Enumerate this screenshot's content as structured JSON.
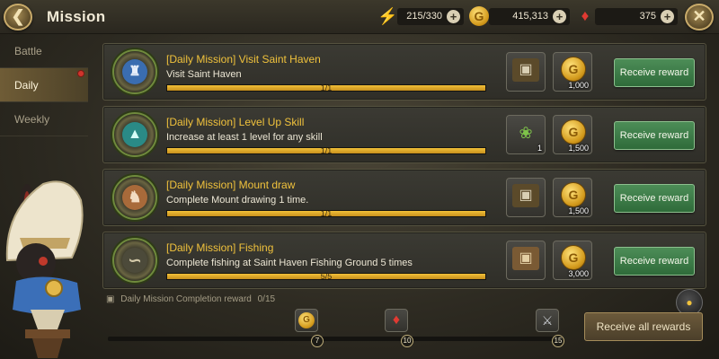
{
  "header": {
    "title": "Mission",
    "back_icon": "back-arrow-icon",
    "close_icon": "close-x-icon",
    "resources": [
      {
        "name": "energy",
        "icon": "lightning-icon",
        "value": "215/330",
        "color": "#6cc24a"
      },
      {
        "name": "gold",
        "icon": "coin-icon",
        "value": "415,313",
        "color": "#e0a624"
      },
      {
        "name": "gem",
        "icon": "ruby-icon",
        "value": "375",
        "color": "#d3322e"
      }
    ]
  },
  "nav": {
    "items": [
      {
        "label": "Battle",
        "active": false
      },
      {
        "label": "Daily",
        "active": true,
        "notification": true
      },
      {
        "label": "Weekly",
        "active": false
      }
    ]
  },
  "missions": [
    {
      "title": "[Daily Mission] Visit Saint Haven",
      "description": "Visit Saint Haven",
      "progress_text": "1/1",
      "progress": 1.0,
      "emblem_icon": "castle-icon",
      "rewards": [
        {
          "icon": "treasure-chest-icon",
          "count": ""
        },
        {
          "icon": "gold-coin-icon",
          "count": "1,000"
        }
      ],
      "button_label": "Receive reward"
    },
    {
      "title": "[Daily Mission] Level Up Skill",
      "description": "Increase at least 1 level for any skill",
      "progress_text": "1/1",
      "progress": 1.0,
      "emblem_icon": "level-up-arrow-icon",
      "rewards": [
        {
          "icon": "green-herb-icon",
          "count": "1"
        },
        {
          "icon": "gold-coin-icon",
          "count": "1,500"
        }
      ],
      "button_label": "Receive reward"
    },
    {
      "title": "[Daily Mission] Mount draw",
      "description": "Complete Mount drawing 1 time.",
      "progress_text": "1/1",
      "progress": 1.0,
      "emblem_icon": "horse-head-icon",
      "rewards": [
        {
          "icon": "treasure-chest-icon",
          "count": ""
        },
        {
          "icon": "gold-coin-icon",
          "count": "1,500"
        }
      ],
      "button_label": "Receive reward"
    },
    {
      "title": "[Daily Mission] Fishing",
      "description": "Complete fishing at Saint Haven Fishing Ground 5 times",
      "progress_text": "5/5",
      "progress": 1.0,
      "emblem_icon": "fishing-rod-icon",
      "rewards": [
        {
          "icon": "wooden-chest-icon",
          "count": ""
        },
        {
          "icon": "gold-coin-icon",
          "count": "3,000"
        }
      ],
      "button_label": "Receive reward"
    }
  ],
  "completion": {
    "label": "Daily Mission Completion reward",
    "progress": "0/15",
    "progress_fraction": 0,
    "milestones": [
      {
        "icon": "gold-coin-icon",
        "value": "7"
      },
      {
        "icon": "ruby-icon",
        "value": "10"
      },
      {
        "icon": "armor-icon",
        "value": "15"
      }
    ],
    "receive_all_label": "Receive all rewards"
  }
}
